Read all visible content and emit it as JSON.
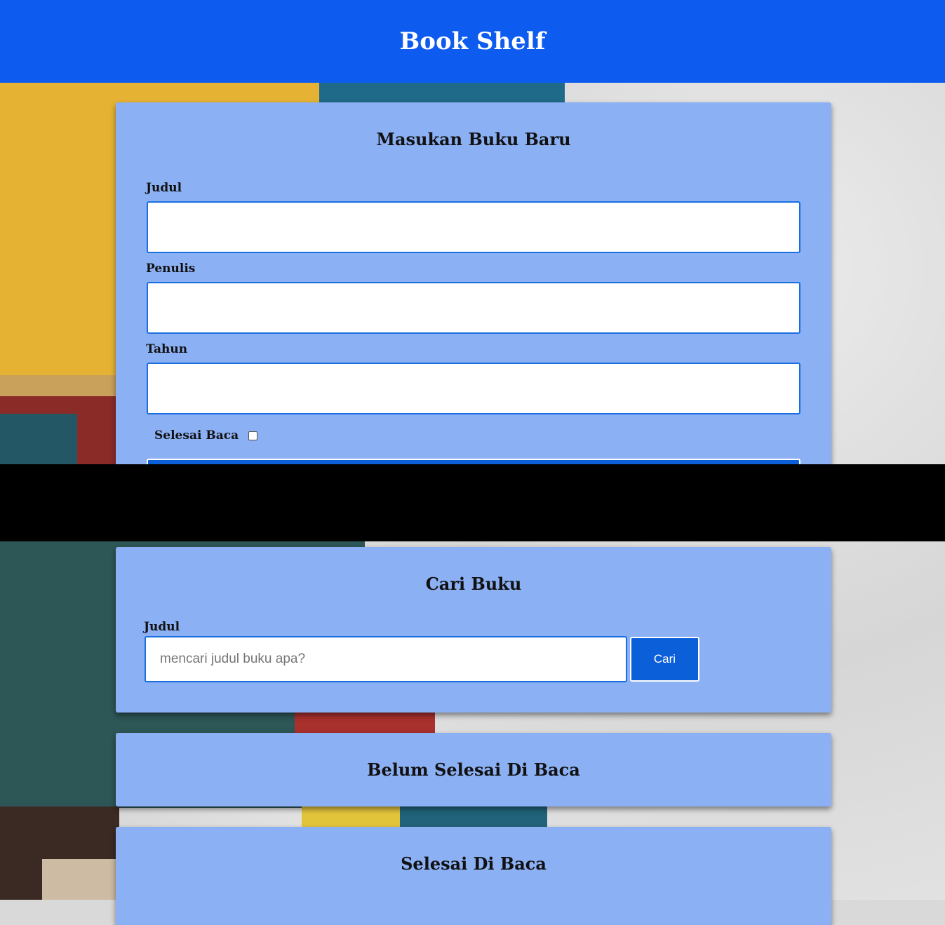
{
  "header": {
    "title": "Book Shelf"
  },
  "input_section": {
    "title": "Masukan Buku Baru",
    "fields": [
      {
        "label": "Judul",
        "value": ""
      },
      {
        "label": "Penulis",
        "value": ""
      },
      {
        "label": "Tahun",
        "value": ""
      }
    ],
    "checkbox_label": "Selesai Baca",
    "checkbox_checked": false
  },
  "search_section": {
    "title": "Cari Buku",
    "label": "Judul",
    "placeholder": "mencari judul buku apa?",
    "button_label": "Cari"
  },
  "unread_section": {
    "title": "Belum Selesai Di Baca"
  },
  "read_section": {
    "title": "Selesai Di Baca"
  },
  "colors": {
    "header": "#0d5cef",
    "card": "#8cb0f4",
    "button": "#0b5fd8",
    "input_border": "#1a6fe0"
  }
}
